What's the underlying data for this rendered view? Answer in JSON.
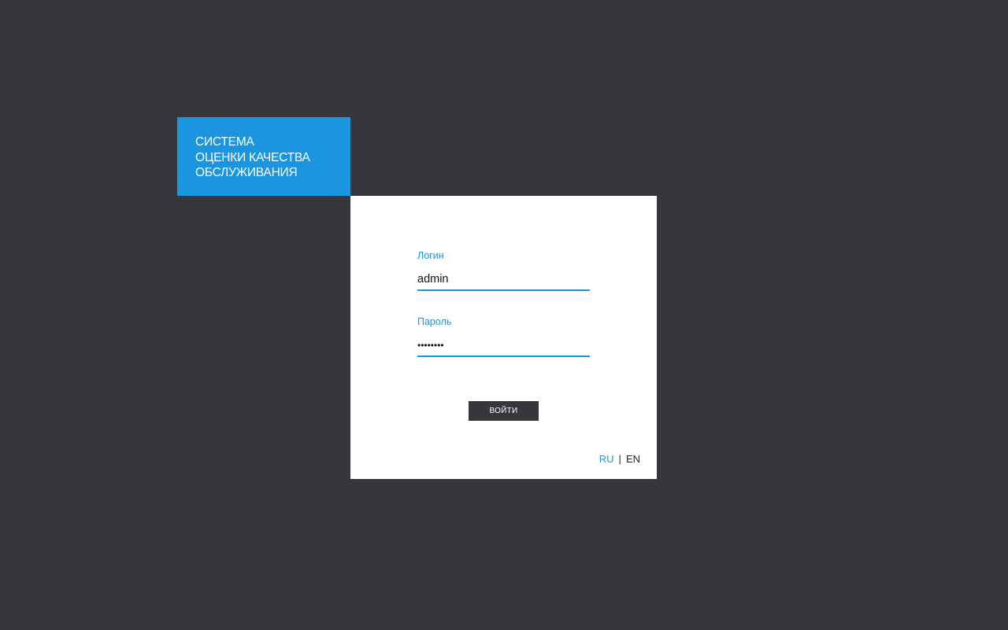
{
  "brand": {
    "lines": [
      "СИСТЕМА",
      "ОЦЕНКИ КАЧЕСТВА",
      "ОБСЛУЖИВАНИЯ"
    ]
  },
  "form": {
    "login_label": "Логин",
    "login_value": "admin",
    "password_label": "Пароль",
    "password_value": "••••••••",
    "submit_label": "ВОЙТИ"
  },
  "language": {
    "ru": "RU",
    "separator": "|",
    "en": "EN",
    "active": "RU"
  },
  "colors": {
    "accent": "#1b95e0",
    "background": "#36373b",
    "card": "#ffffff"
  }
}
